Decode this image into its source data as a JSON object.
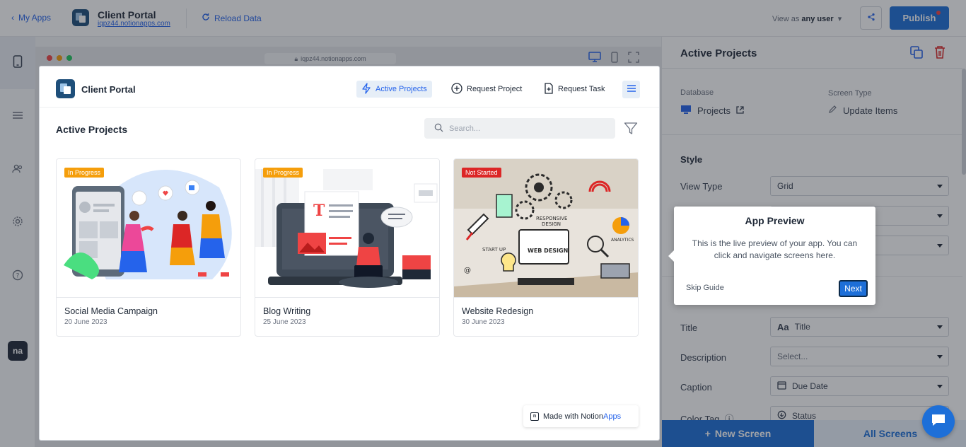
{
  "topbar": {
    "back_label": "My Apps",
    "app_title": "Client Portal",
    "app_url": "iqpz44.notionapps.com",
    "reload_label": "Reload Data",
    "view_as_prefix": "View as",
    "view_as_value": "any user",
    "publish_label": "Publish"
  },
  "browser": {
    "url": "iqpz44.notionapps.com"
  },
  "preview": {
    "title": "Client Portal",
    "nav": [
      {
        "label": "Active Projects"
      },
      {
        "label": "Request Project"
      },
      {
        "label": "Request Task"
      }
    ],
    "heading": "Active Projects",
    "search_placeholder": "Search...",
    "cards": [
      {
        "title": "Social Media Campaign",
        "date": "20 June 2023",
        "status": "In Progress",
        "status_color": "#f59e0b"
      },
      {
        "title": "Blog Writing",
        "date": "25 June 2023",
        "status": "In Progress",
        "status_color": "#f59e0b"
      },
      {
        "title": "Website Redesign",
        "date": "30 June 2023",
        "status": "Not Started",
        "status_color": "#dc2626"
      }
    ],
    "made_with_prefix": "Made with Notion",
    "made_with_brand": "Apps"
  },
  "panel": {
    "title": "Active Projects",
    "database_label": "Database",
    "database_value": "Projects",
    "screen_type_label": "Screen Type",
    "screen_type_value": "Update Items",
    "style_heading": "Style",
    "view_type_label": "View Type",
    "view_type_value": "Grid",
    "fields": [
      {
        "label": "Title",
        "value": "Title",
        "icon": "text-icon"
      },
      {
        "label": "Description",
        "value": "Select..."
      },
      {
        "label": "Caption",
        "value": "Due Date",
        "icon": "calendar-icon"
      },
      {
        "label": "Color Tag",
        "value": "Status",
        "icon": "status-icon"
      }
    ],
    "new_screen_label": "New Screen",
    "all_screens_label": "All Screens"
  },
  "guide": {
    "title": "App Preview",
    "body": "This is the live preview of your app. You can click and navigate screens here.",
    "skip_label": "Skip Guide",
    "next_label": "Next"
  },
  "colors": {
    "accent": "#1d6fd8",
    "in_progress": "#f59e0b",
    "not_started": "#dc2626"
  }
}
